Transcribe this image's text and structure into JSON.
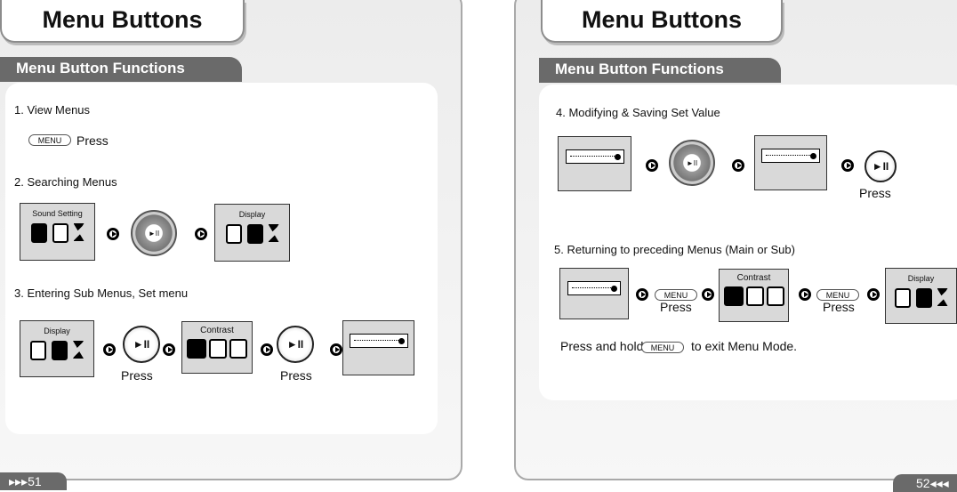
{
  "left": {
    "title": "Menu Buttons",
    "section": "Menu Button Functions",
    "step1": {
      "heading": "1. View Menus",
      "button": "MENU",
      "action": "Press"
    },
    "step2": {
      "heading": "2. Searching Menus",
      "screen1": "Sound Setting",
      "screen2": "Display"
    },
    "step3": {
      "heading": "3. Entering Sub Menus, Set menu",
      "screen1": "Display",
      "action1": "Press",
      "screen2": "Contrast",
      "action2": "Press"
    },
    "page_number": "51"
  },
  "right": {
    "title": "Menu Buttons",
    "section": "Menu Button Functions",
    "step4": {
      "heading": "4. Modifying & Saving Set Value",
      "action": "Press"
    },
    "step5": {
      "heading": "5. Returning to preceding Menus (Main or Sub)",
      "button": "MENU",
      "action": "Press",
      "screen1": "Contrast",
      "screen2": "Display"
    },
    "note": {
      "before": "Press and hold",
      "button": "MENU",
      "after": "to exit Menu Mode."
    },
    "page_number": "52"
  },
  "icons": {
    "play_pause": "►II",
    "wheel": "navigation-wheel"
  }
}
